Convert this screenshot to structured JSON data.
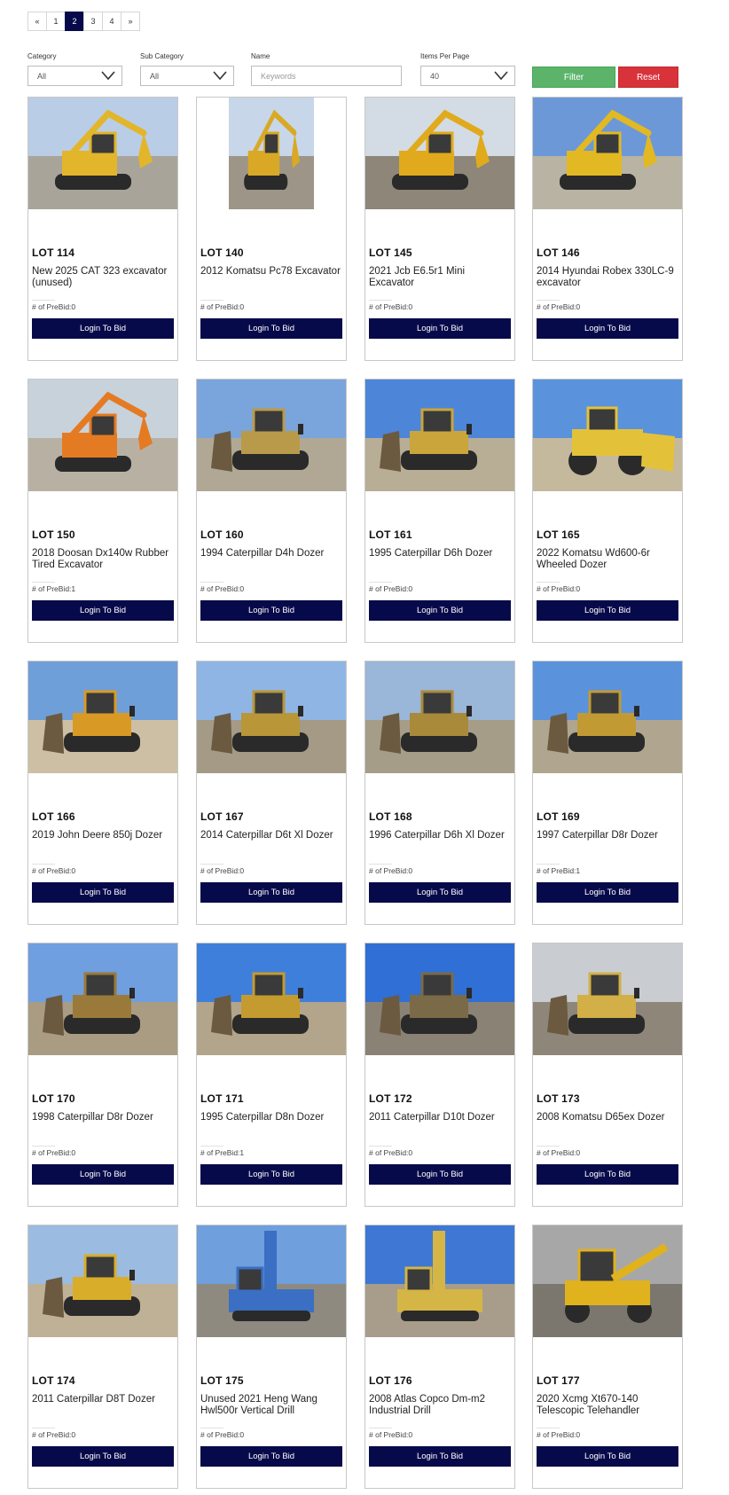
{
  "pagination": {
    "prev": "«",
    "pages": [
      "1",
      "2",
      "3",
      "4"
    ],
    "active": "2",
    "next": "»"
  },
  "filters": {
    "category": {
      "label": "Category",
      "value": "All"
    },
    "subcategory": {
      "label": "Sub Category",
      "value": "All"
    },
    "name": {
      "label": "Name",
      "placeholder": "Keywords"
    },
    "per_page": {
      "label": "Items Per Page",
      "value": "40"
    },
    "filter_label": "Filter",
    "reset_label": "Reset"
  },
  "prebid_prefix": "# of PreBid:",
  "bid_label": "Login To Bid",
  "lots": [
    {
      "lot": "LOT 114",
      "title": "New 2025 CAT 323 excavator (unused)",
      "prebid": "0",
      "photo": "excavator",
      "sky": "#b9cde6",
      "ground": "#a9a49a",
      "machine": "#e3b52a"
    },
    {
      "lot": "LOT 140",
      "title": "2012 Komatsu Pc78 Excavator",
      "prebid": "0",
      "photo": "excavator",
      "sky": "#c7d6e8",
      "ground": "#9d9587",
      "machine": "#d9a925"
    },
    {
      "lot": "LOT 145",
      "title": "2021 Jcb E6.5r1 Mini Excavator",
      "prebid": "0",
      "photo": "excavator",
      "sky": "#d3dbe4",
      "ground": "#8d8679",
      "machine": "#e0aa1c"
    },
    {
      "lot": "LOT 146",
      "title": "2014 Hyundai Robex 330LC-9 excavator",
      "prebid": "0",
      "photo": "excavator",
      "sky": "#6c98d8",
      "ground": "#b9b3a4",
      "machine": "#e2b922"
    },
    {
      "lot": "LOT 150",
      "title": "2018 Doosan Dx140w Rubber Tired Excavator",
      "prebid": "1",
      "photo": "excavator",
      "sky": "#c8d2db",
      "ground": "#b8b1a3",
      "machine": "#e47a22"
    },
    {
      "lot": "LOT 160",
      "title": "1994 Caterpillar D4h Dozer",
      "prebid": "0",
      "photo": "dozer",
      "sky": "#7aa4dc",
      "ground": "#b0a894",
      "machine": "#b99a4a"
    },
    {
      "lot": "LOT 161",
      "title": "1995 Caterpillar D6h Dozer",
      "prebid": "0",
      "photo": "dozer",
      "sky": "#4d86d8",
      "ground": "#b8ad95",
      "machine": "#c9a53b"
    },
    {
      "lot": "LOT 165",
      "title": "2022 Komatsu Wd600-6r Wheeled Dozer",
      "prebid": "0",
      "photo": "loader",
      "sky": "#5a92dc",
      "ground": "#c4b89d",
      "machine": "#e3c23a"
    },
    {
      "lot": "LOT 166",
      "title": "2019 John Deere 850j Dozer",
      "prebid": "0",
      "photo": "dozer",
      "sky": "#6f9fd8",
      "ground": "#cdbfa4",
      "machine": "#d89a25"
    },
    {
      "lot": "LOT 167",
      "title": "2014 Caterpillar D6t Xl Dozer",
      "prebid": "0",
      "photo": "dozer",
      "sky": "#8fb5e4",
      "ground": "#a49a86",
      "machine": "#b99638"
    },
    {
      "lot": "LOT 168",
      "title": "1996 Caterpillar D6h Xl Dozer",
      "prebid": "0",
      "photo": "dozer",
      "sky": "#9ab6d8",
      "ground": "#a69d89",
      "machine": "#a88a3a"
    },
    {
      "lot": "LOT 169",
      "title": "1997 Caterpillar D8r Dozer",
      "prebid": "1",
      "photo": "dozer",
      "sky": "#5a92dc",
      "ground": "#b0a68f",
      "machine": "#c19a34"
    },
    {
      "lot": "LOT 170",
      "title": "1998 Caterpillar D8r Dozer",
      "prebid": "0",
      "photo": "dozer",
      "sky": "#6f9fdf",
      "ground": "#a99c83",
      "machine": "#9a7a3a"
    },
    {
      "lot": "LOT 171",
      "title": "1995 Caterpillar D8n Dozer",
      "prebid": "1",
      "photo": "dozer",
      "sky": "#3f7fdc",
      "ground": "#b3a58b",
      "machine": "#c49b2e"
    },
    {
      "lot": "LOT 172",
      "title": "2011 Caterpillar D10t Dozer",
      "prebid": "0",
      "photo": "dozer",
      "sky": "#2f6fd6",
      "ground": "#8a8274",
      "machine": "#7a6a48"
    },
    {
      "lot": "LOT 173",
      "title": "2008 Komatsu D65ex Dozer",
      "prebid": "0",
      "photo": "dozer",
      "sky": "#c9cdd2",
      "ground": "#8e8779",
      "machine": "#d2b047"
    },
    {
      "lot": "LOT 174",
      "title": "2011 Caterpillar D8T Dozer",
      "prebid": "0",
      "photo": "dozer",
      "sky": "#9cbbe0",
      "ground": "#bfb196",
      "machine": "#d8ad2a"
    },
    {
      "lot": "LOT 175",
      "title": "Unused 2021 Heng Wang Hwl500r Vertical Drill",
      "prebid": "0",
      "photo": "drill",
      "sky": "#6f9fdc",
      "ground": "#8f8a80",
      "machine": "#3a6fc4"
    },
    {
      "lot": "LOT 176",
      "title": "2008 Atlas Copco Dm-m2 Industrial Drill",
      "prebid": "0",
      "photo": "drill",
      "sky": "#3e78d4",
      "ground": "#a89d8a",
      "machine": "#d4b545"
    },
    {
      "lot": "LOT 177",
      "title": "2020 Xcmg Xt670-140 Telescopic Telehandler",
      "prebid": "0",
      "photo": "telehandler",
      "sky": "#a7a7a7",
      "ground": "#7c776e",
      "machine": "#e0b21e"
    }
  ]
}
